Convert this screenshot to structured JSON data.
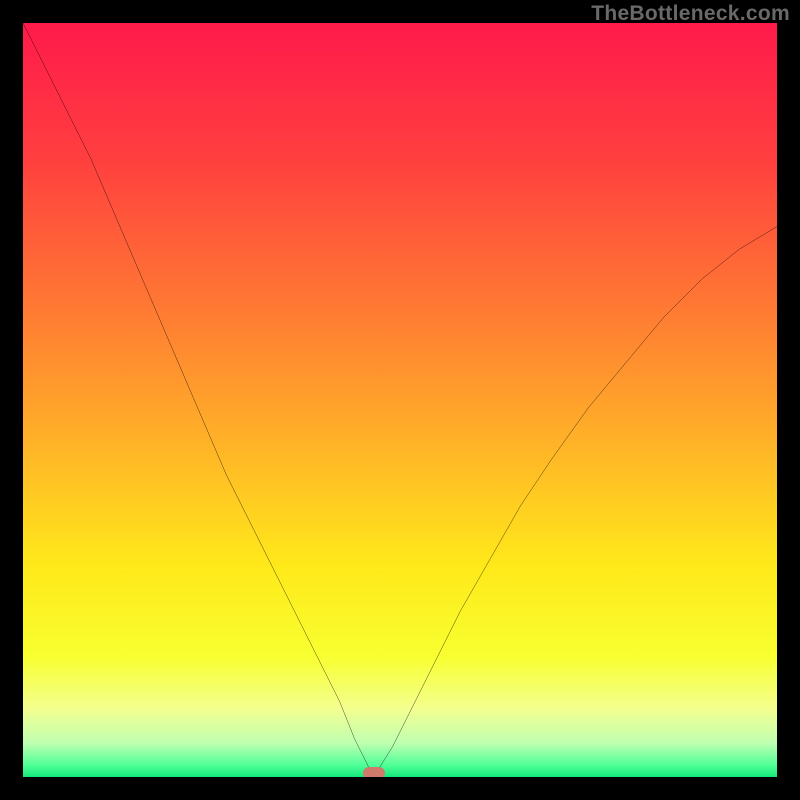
{
  "watermark": "TheBottleneck.com",
  "marker": {
    "x_pct": 46.5,
    "y_pct": 99.5,
    "color": "#cf7a6b"
  },
  "gradient_stops": [
    {
      "pos": 0,
      "color": "#ff1a4b"
    },
    {
      "pos": 0.18,
      "color": "#ff3f3f"
    },
    {
      "pos": 0.38,
      "color": "#ff7a33"
    },
    {
      "pos": 0.55,
      "color": "#ffb028"
    },
    {
      "pos": 0.72,
      "color": "#ffe91a"
    },
    {
      "pos": 0.84,
      "color": "#f8ff30"
    },
    {
      "pos": 0.91,
      "color": "#f3ff90"
    },
    {
      "pos": 0.955,
      "color": "#bfffb0"
    },
    {
      "pos": 0.985,
      "color": "#4dff97"
    },
    {
      "pos": 1.0,
      "color": "#14e87a"
    }
  ],
  "chart_data": {
    "type": "line",
    "title": "",
    "xlabel": "",
    "ylabel": "",
    "xlim": [
      0,
      100
    ],
    "ylim": [
      0,
      100
    ],
    "grid": false,
    "legend": false,
    "x": [
      0,
      3,
      6,
      9,
      12,
      15,
      18,
      21,
      24,
      27,
      30,
      33,
      36,
      39,
      42,
      44,
      46.5,
      49,
      52,
      55,
      58,
      62,
      66,
      70,
      75,
      80,
      85,
      90,
      95,
      100
    ],
    "y": [
      100,
      94,
      88,
      82,
      75,
      68,
      61,
      54,
      47,
      40,
      34,
      28,
      22,
      16,
      10,
      5,
      0,
      4,
      10,
      16,
      22,
      29,
      36,
      42,
      49,
      55,
      61,
      66,
      70,
      73
    ],
    "annotations": [
      {
        "text": "TheBottleneck.com",
        "position": "top-right"
      }
    ],
    "optimum_x": 46.5
  }
}
